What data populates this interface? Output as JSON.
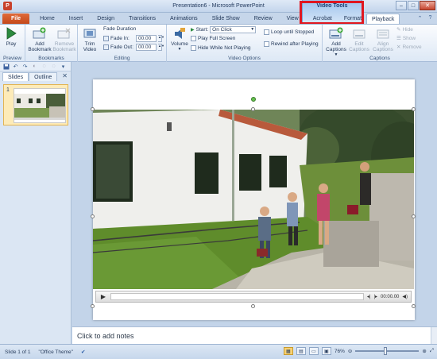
{
  "window": {
    "title": "Presentation6 - Microsoft PowerPoint",
    "app_icon": "P",
    "minimize": "–",
    "maximize": "□",
    "close": "✕"
  },
  "contextual": {
    "label": "Video Tools",
    "highlight_color": "#e0171f"
  },
  "tabs": [
    {
      "label": "File"
    },
    {
      "label": "Home"
    },
    {
      "label": "Insert"
    },
    {
      "label": "Design"
    },
    {
      "label": "Transitions"
    },
    {
      "label": "Animations"
    },
    {
      "label": "Slide Show"
    },
    {
      "label": "Review"
    },
    {
      "label": "View"
    },
    {
      "label": "Acrobat"
    },
    {
      "label": "Format"
    },
    {
      "label": "Playback"
    }
  ],
  "ribbon": {
    "preview": {
      "label": "Preview",
      "play": "Play"
    },
    "bookmarks": {
      "label": "Bookmarks",
      "add": "Add Bookmark",
      "remove": "Remove Bookmark"
    },
    "editing": {
      "label": "Editing",
      "trim": "Trim Video",
      "fade_duration": "Fade Duration",
      "fade_in_label": "Fade In:",
      "fade_in_value": "00.00",
      "fade_out_label": "Fade Out:",
      "fade_out_value": "00.00"
    },
    "video_options": {
      "label": "Video Options",
      "volume": "Volume",
      "start_label": "Start:",
      "start_value": "On Click",
      "play_full_screen": "Play Full Screen",
      "hide_while_not_playing": "Hide While Not Playing",
      "loop": "Loop until Stopped",
      "rewind": "Rewind after Playing"
    },
    "captions": {
      "label": "Captions",
      "add": "Add Captions",
      "edit": "Edit Captions",
      "align": "Align Captions",
      "hide": "Hide",
      "show": "Show",
      "remove": "Remove"
    }
  },
  "left_pane": {
    "tab_slides": "Slides",
    "tab_outline": "Outline",
    "slide_number": "1",
    "close": "✕"
  },
  "player": {
    "time": "00:00.00"
  },
  "notes": {
    "placeholder": "Click to add notes"
  },
  "status": {
    "slide": "Slide 1 of 1",
    "theme": "\"Office Theme\"",
    "zoom": "76%"
  },
  "colors": {
    "file_tab": "#c4481a",
    "ribbon_bg": "#dde8f5",
    "accent": "#1c3f72"
  }
}
